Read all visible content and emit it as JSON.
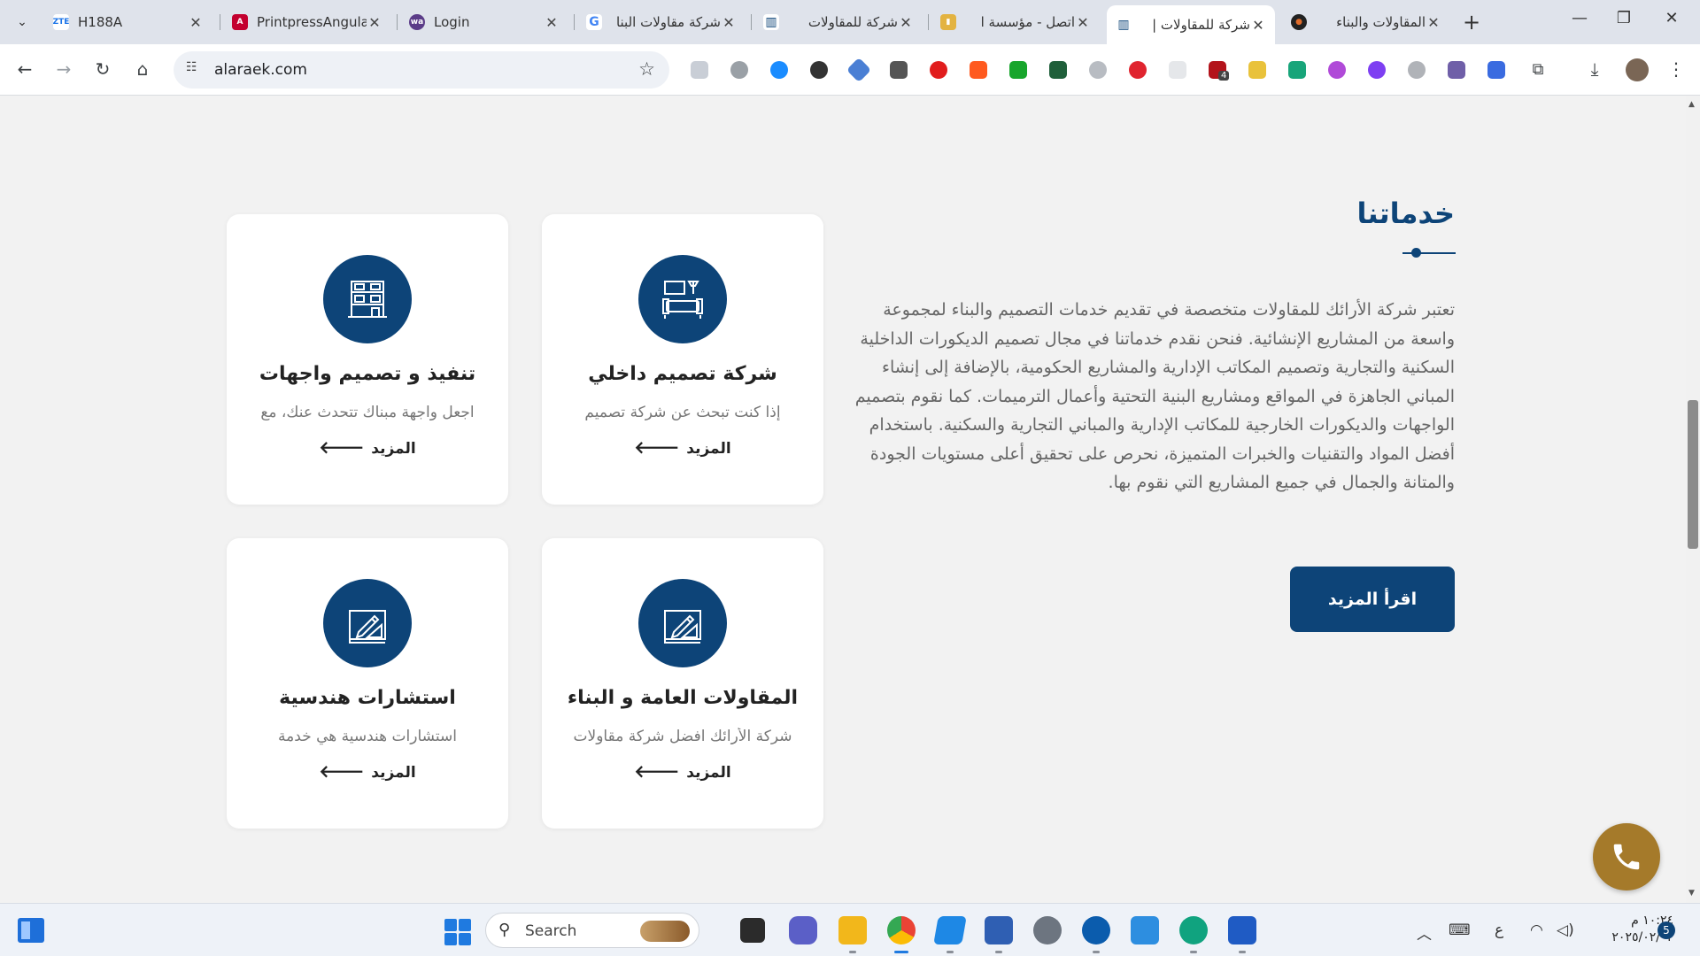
{
  "browser": {
    "tabs": [
      {
        "title": "H188A",
        "favicon_text": "ZTE",
        "favicon_color": "#ffffff",
        "favicon_text_color": "#1a73e8"
      },
      {
        "title": "PrintpressAngula",
        "favicon_text": "A",
        "favicon_color": "#c3002f",
        "favicon_text_color": "#ffffff"
      },
      {
        "title": "Login",
        "favicon_text": "wa",
        "favicon_color": "#5b3c88",
        "favicon_text_color": "#ffffff"
      },
      {
        "title": "شركة مقاولات البنا",
        "favicon_text": "G",
        "favicon_color": "#ffffff",
        "favicon_text_color": "#4285f4"
      },
      {
        "title": "شركة للمقاولات",
        "favicon_text": "▥",
        "favicon_color": "#ffffff",
        "favicon_text_color": "#0d4478"
      },
      {
        "title": "اتصل - مؤسسة ا",
        "favicon_text": "▮",
        "favicon_color": "#e3b341",
        "favicon_text_color": "#ffffff"
      },
      {
        "title": "شركة للمقاولات |",
        "favicon_text": "▥",
        "favicon_color": "#ffffff",
        "favicon_text_color": "#0d4478"
      },
      {
        "title": "المقاولات والبناء",
        "favicon_text": "●",
        "favicon_color": "#222222",
        "favicon_text_color": "#e06c2b"
      }
    ],
    "active_tab_index": 6,
    "url": "alaraek.com",
    "extension_badge": "4"
  },
  "section": {
    "title": "خدماتنا",
    "paragraph": "تعتبر شركة الأرائك للمقاولات متخصصة في تقديم خدمات التصميم والبناء لمجموعة واسعة من المشاريع الإنشائية. فنحن نقدم خدماتنا في مجال تصميم الديكورات الداخلية السكنية والتجارية وتصميم المكاتب الإدارية والمشاريع الحكومية، بالإضافة إلى إنشاء المباني الجاهزة في المواقع ومشاريع البنية التحتية وأعمال الترميمات. كما نقوم بتصميم الواجهات والديكورات الخارجية للمكاتب الإدارية والمباني التجارية والسكنية. باستخدام أفضل المواد والتقنيات والخبرات المتميزة، نحرص على تحقيق أعلى مستويات الجودة والمتانة والجمال في جميع المشاريع التي نقوم بها.",
    "read_more_label": "اقرأ المزيد"
  },
  "cards": [
    {
      "title": "شركة تصميم داخلي",
      "desc": "إذا كنت تبحث عن شركة تصميم",
      "more": "المزيد",
      "icon": "interior-design-icon"
    },
    {
      "title": "تنفيذ و تصميم واجهات",
      "desc": "اجعل واجهة مبناك تتحدث عنك، مع",
      "more": "المزيد",
      "icon": "facade-icon"
    },
    {
      "title": "المقاولات العامة و البناء",
      "desc": "شركة الأرائك افضل شركة مقاولات",
      "more": "المزيد",
      "icon": "blueprint-icon"
    },
    {
      "title": "استشارات هندسية",
      "desc": "استشارات هندسية هي خدمة",
      "more": "المزيد",
      "icon": "blueprint-icon"
    }
  ],
  "colors": {
    "brand": "#0d4478",
    "phone_button": "#a57a2a",
    "whatsapp_button": "#25d366"
  },
  "taskbar": {
    "search_label": "Search",
    "time": "١٠:٢٤ م",
    "date": "٢٠٢٥/٠٢/٠٣",
    "lang": "ع",
    "notifications": "5"
  }
}
